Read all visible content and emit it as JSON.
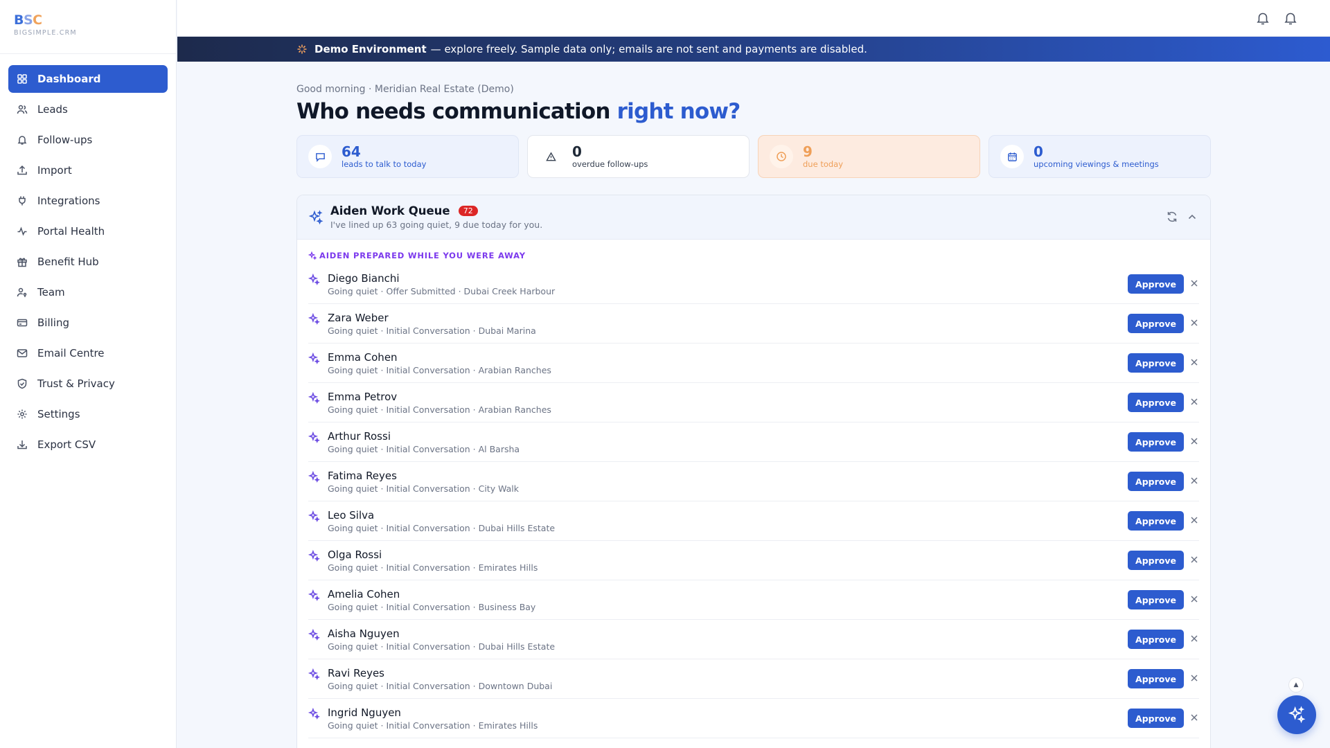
{
  "brand": {
    "logo": "BSC",
    "sub": "BIGSIMPLE.CRM"
  },
  "sidebar": {
    "items": [
      {
        "label": "Dashboard",
        "icon": "dashboard-grid-icon",
        "active": true
      },
      {
        "label": "Leads",
        "icon": "users-icon"
      },
      {
        "label": "Follow-ups",
        "icon": "bell-icon"
      },
      {
        "label": "Import",
        "icon": "upload-icon"
      },
      {
        "label": "Integrations",
        "icon": "plug-icon"
      },
      {
        "label": "Portal Health",
        "icon": "activity-icon"
      },
      {
        "label": "Benefit Hub",
        "icon": "gift-icon"
      },
      {
        "label": "Team",
        "icon": "user-key-icon"
      },
      {
        "label": "Billing",
        "icon": "credit-card-icon"
      },
      {
        "label": "Email Centre",
        "icon": "mail-icon"
      },
      {
        "label": "Trust & Privacy",
        "icon": "shield-check-icon"
      },
      {
        "label": "Settings",
        "icon": "gear-icon"
      },
      {
        "label": "Export CSV",
        "icon": "download-icon"
      }
    ]
  },
  "banner": {
    "title": "Demo Environment",
    "text": "— explore freely. Sample data only; emails are not sent and payments are disabled."
  },
  "main": {
    "greeting": "Good morning · Meridian Real Estate (Demo)",
    "headline": "Who needs communication",
    "headline_accent": "right now?"
  },
  "stats": [
    {
      "value": "64",
      "label": "leads to talk to today"
    },
    {
      "value": "0",
      "label": "overdue follow-ups"
    },
    {
      "value": "9",
      "label": "due today"
    },
    {
      "value": "0",
      "label": "upcoming viewings & meetings"
    }
  ],
  "queue": {
    "title": "Aiden Work Queue",
    "badge": "72",
    "subtitle": "I've lined up 63 going quiet, 9 due today for you.",
    "section_label": "AIDEN PREPARED WHILE YOU WERE AWAY",
    "approve_label": "Approve",
    "rows": [
      {
        "name": "Diego Bianchi",
        "meta": "Going quiet · Offer Submitted · Dubai Creek Harbour"
      },
      {
        "name": "Zara Weber",
        "meta": "Going quiet · Initial Conversation · Dubai Marina"
      },
      {
        "name": "Emma Cohen",
        "meta": "Going quiet · Initial Conversation · Arabian Ranches"
      },
      {
        "name": "Emma Petrov",
        "meta": "Going quiet · Initial Conversation · Arabian Ranches"
      },
      {
        "name": "Arthur Rossi",
        "meta": "Going quiet · Initial Conversation · Al Barsha"
      },
      {
        "name": "Fatima Reyes",
        "meta": "Going quiet · Initial Conversation · City Walk"
      },
      {
        "name": "Leo Silva",
        "meta": "Going quiet · Initial Conversation · Dubai Hills Estate"
      },
      {
        "name": "Olga Rossi",
        "meta": "Going quiet · Initial Conversation · Emirates Hills"
      },
      {
        "name": "Amelia Cohen",
        "meta": "Going quiet · Initial Conversation · Business Bay"
      },
      {
        "name": "Aisha Nguyen",
        "meta": "Going quiet · Initial Conversation · Dubai Hills Estate"
      },
      {
        "name": "Ravi Reyes",
        "meta": "Going quiet · Initial Conversation · Downtown Dubai"
      },
      {
        "name": "Ingrid Nguyen",
        "meta": "Going quiet · Initial Conversation · Emirates Hills"
      }
    ]
  },
  "colors": {
    "accent": "#2d5ccf",
    "warning": "#ef9f58",
    "badge": "#dc2626",
    "sparkle": "#6d4de3"
  }
}
